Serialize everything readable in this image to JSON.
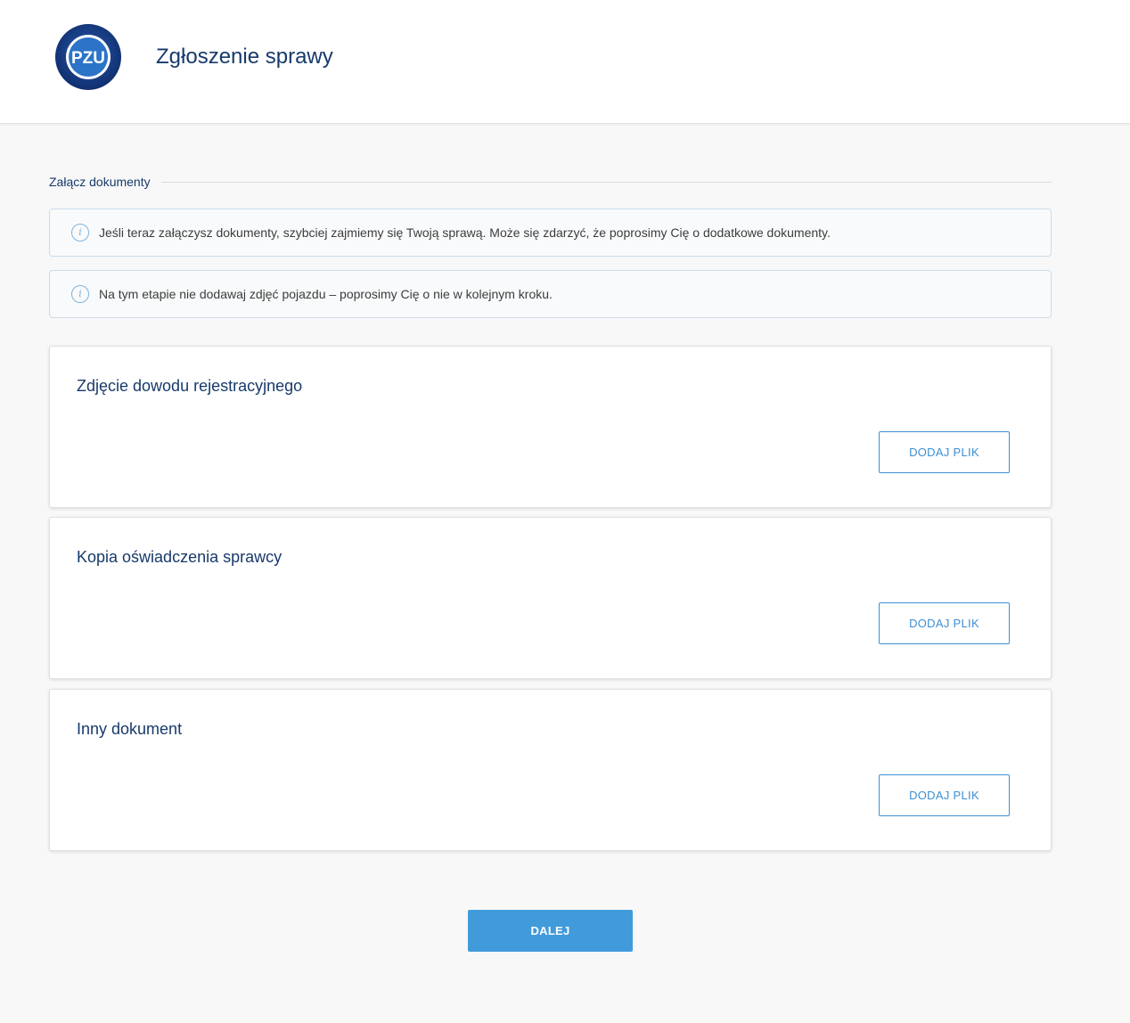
{
  "header": {
    "logo_text": "PZU",
    "title": "Zgłoszenie sprawy"
  },
  "section": {
    "label": "Załącz dokumenty"
  },
  "info": [
    {
      "icon": "info-icon",
      "glyph": "i",
      "text": "Jeśli teraz załączysz dokumenty, szybciej zajmiemy się Twoją sprawą. Może się zdarzyć, że poprosimy Cię o dodatkowe dokumenty."
    },
    {
      "icon": "info-icon",
      "glyph": "i",
      "text": "Na tym etapie nie dodawaj zdjęć pojazdu – poprosimy Cię o nie w kolejnym kroku."
    }
  ],
  "documents": [
    {
      "title": "Zdjęcie dowodu rejestracyjnego",
      "button": "DODAJ PLIK"
    },
    {
      "title": "Kopia oświadczenia sprawcy",
      "button": "DODAJ PLIK"
    },
    {
      "title": "Inny dokument",
      "button": "DODAJ PLIK"
    }
  ],
  "footer": {
    "next_label": "DALEJ"
  },
  "colors": {
    "brand_navy": "#173a6b",
    "accent_blue": "#419bdb",
    "link_blue": "#3d8fd2",
    "info_border": "#c9dcec",
    "background": "#f8f8f8"
  }
}
